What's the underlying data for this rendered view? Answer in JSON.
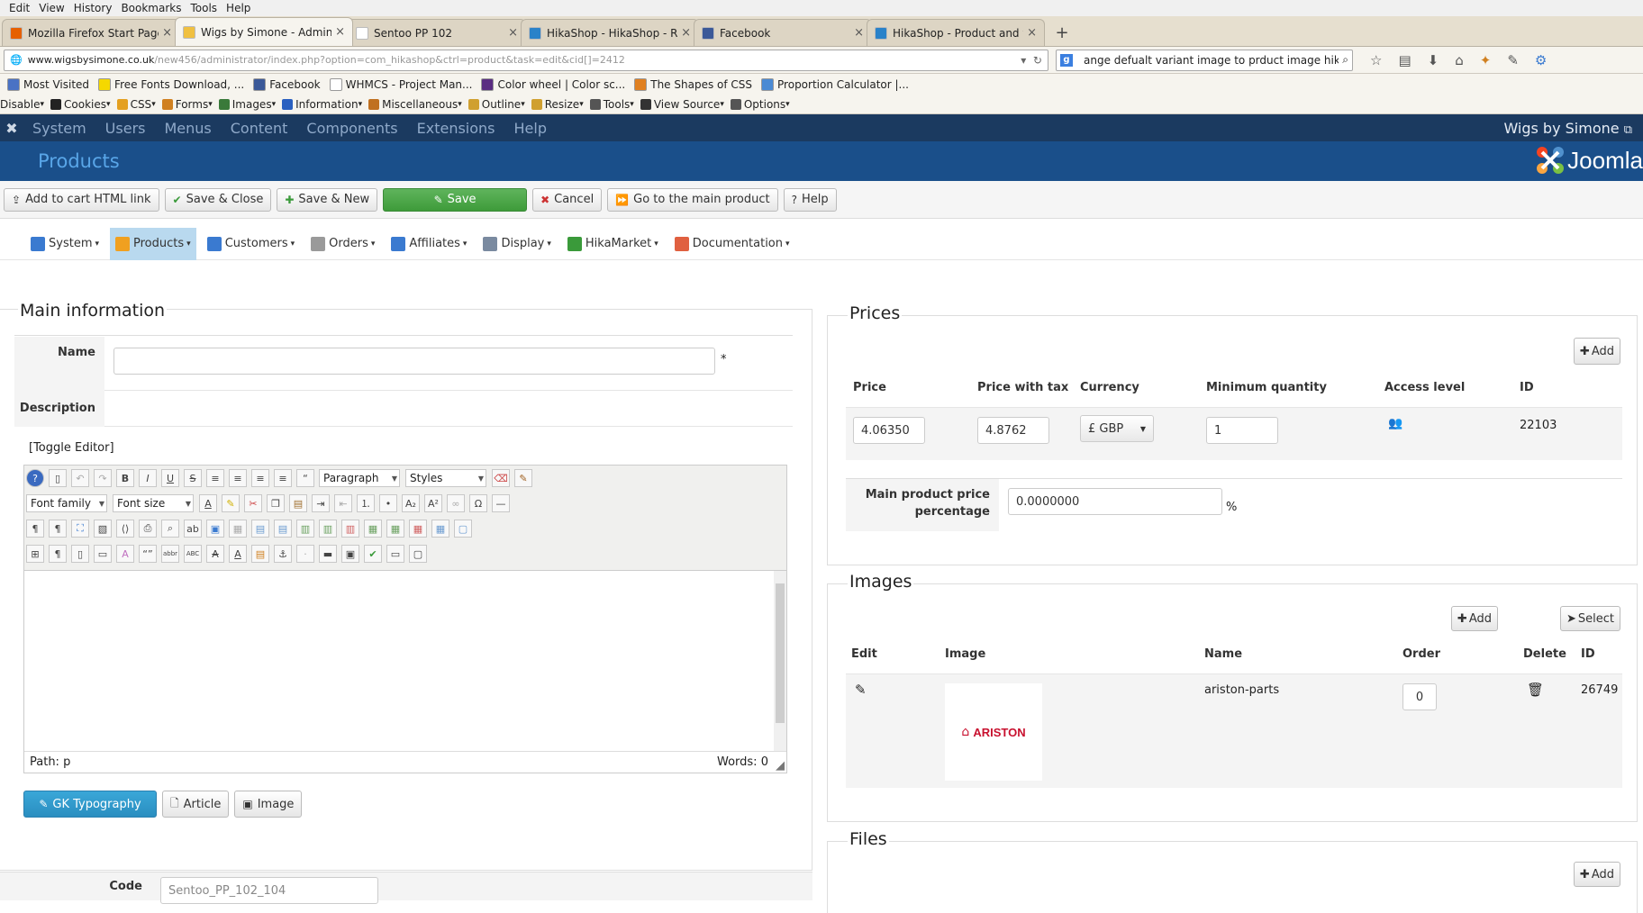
{
  "browser": {
    "menu": [
      "Edit",
      "View",
      "History",
      "Bookmarks",
      "Tools",
      "Help"
    ],
    "tabs": [
      {
        "title": "Mozilla Firefox Start Page",
        "active": false,
        "color": "#e66000"
      },
      {
        "title": "Wigs by Simone - Adminis...",
        "active": true,
        "color": "#f0c040"
      },
      {
        "title": "Sentoo PP 102",
        "active": false,
        "color": "#ffffff"
      },
      {
        "title": "HikaShop - HikaShop - Re...",
        "active": false,
        "color": "#2a82c9"
      },
      {
        "title": "Facebook",
        "active": false,
        "color": "#3b5998"
      },
      {
        "title": "HikaShop - Product and va...",
        "active": false,
        "color": "#2a82c9"
      }
    ],
    "tab_close": "×",
    "new_tab": "+",
    "url_host": "www.wigsbysimone.co.uk",
    "url_path": "/new456/administrator/index.php?option=com_hikashop&ctrl=product&task=edit&cid[]=2412",
    "search_value": "ange defualt variant image to prduct image hikashop",
    "bookmarks": [
      {
        "label": "Most Visited",
        "color": "#4a72c4"
      },
      {
        "label": "Free Fonts Download, ...",
        "color": "#f5d800"
      },
      {
        "label": "Facebook",
        "color": "#3b5998"
      },
      {
        "label": "WHMCS - Project Man...",
        "color": "#ffffff"
      },
      {
        "label": "Color wheel | Color sc...",
        "color": "#5a2d82"
      },
      {
        "label": "The Shapes of CSS",
        "color": "#e08020"
      },
      {
        "label": "Proportion Calculator |...",
        "color": "#4a8ad4"
      }
    ],
    "webdev": [
      {
        "label": "Disable",
        "color": ""
      },
      {
        "label": "Cookies",
        "color": "#222"
      },
      {
        "label": "CSS",
        "color": "#e4a020"
      },
      {
        "label": "Forms",
        "color": "#d08020"
      },
      {
        "label": "Images",
        "color": "#3a7a3a"
      },
      {
        "label": "Information",
        "color": "#2a60c0"
      },
      {
        "label": "Miscellaneous",
        "color": "#c07020"
      },
      {
        "label": "Outline",
        "color": "#d0a030"
      },
      {
        "label": "Resize",
        "color": "#d0a030"
      },
      {
        "label": "Tools",
        "color": "#555"
      },
      {
        "label": "View Source",
        "color": "#333"
      },
      {
        "label": "Options",
        "color": "#555"
      }
    ]
  },
  "joomla": {
    "topmenu": [
      "System",
      "Users",
      "Menus",
      "Content",
      "Components",
      "Extensions",
      "Help"
    ],
    "site_name": "Wigs by Simone",
    "page_title": "Products",
    "logo_text": "Joomla",
    "toolbar": [
      {
        "label": "Add to cart HTML link",
        "icon": "⇪",
        "style": "normal"
      },
      {
        "label": "Save & Close",
        "icon": "✔",
        "style": "normal"
      },
      {
        "label": "Save & New",
        "icon": "✚",
        "style": "normal"
      },
      {
        "label": "Save",
        "icon": "✎",
        "style": "green"
      },
      {
        "label": "Cancel",
        "icon": "✖",
        "style": "normal"
      },
      {
        "label": "Go to the main product",
        "icon": "⏩",
        "style": "normal"
      },
      {
        "label": "Help",
        "icon": "?",
        "style": "normal"
      }
    ]
  },
  "hikashop_menu": [
    {
      "label": "System",
      "color": "#3a7ad0",
      "active": false
    },
    {
      "label": "Products",
      "color": "#f0a020",
      "active": true
    },
    {
      "label": "Customers",
      "color": "#3a7ad0",
      "active": false
    },
    {
      "label": "Orders",
      "color": "#9a9a9a",
      "active": false
    },
    {
      "label": "Affiliates",
      "color": "#3a7ad0",
      "active": false
    },
    {
      "label": "Display",
      "color": "#7a8aa0",
      "active": false
    },
    {
      "label": "HikaMarket",
      "color": "#3a9a3a",
      "active": false
    },
    {
      "label": "Documentation",
      "color": "#e06040",
      "active": false
    }
  ],
  "main_info": {
    "title": "Main information",
    "name_label": "Name",
    "name_value": "",
    "required_mark": "*",
    "description_label": "Description",
    "toggle_editor": "[Toggle Editor]",
    "format_select": "Paragraph",
    "styles_select": "Styles",
    "font_family": "Font family",
    "font_size": "Font size",
    "path_label": "Path:",
    "path_value": "p",
    "words_label": "Words:",
    "words_value": "0",
    "editor_buttons": [
      {
        "label": "GK Typography",
        "icon": "✎",
        "primary": true
      },
      {
        "label": "Article",
        "icon": "🗋",
        "primary": false
      },
      {
        "label": "Image",
        "icon": "▣",
        "primary": false
      }
    ],
    "code_label": "Code",
    "code_value": "Sentoo_PP_102_104"
  },
  "prices": {
    "title": "Prices",
    "add_label": "Add",
    "headers": [
      "Price",
      "Price with tax",
      "Currency",
      "Minimum quantity",
      "Access level",
      "ID"
    ],
    "row": {
      "price": "4.06350",
      "price_with_tax": "4.8762",
      "currency": "£ GBP",
      "min_qty": "1",
      "id": "22103"
    },
    "main_pct_label_1": "Main product price",
    "main_pct_label_2": "percentage",
    "main_pct_value": "0.0000000",
    "pct_sign": "%"
  },
  "images": {
    "title": "Images",
    "add_label": "Add",
    "select_label": "Select",
    "headers": [
      "Edit",
      "Image",
      "Name",
      "Order",
      "Delete",
      "ID"
    ],
    "row": {
      "brand": "ARISTON",
      "name": "ariston-parts",
      "order": "0",
      "id": "26749"
    }
  },
  "files": {
    "title": "Files",
    "add_label": "Add"
  }
}
